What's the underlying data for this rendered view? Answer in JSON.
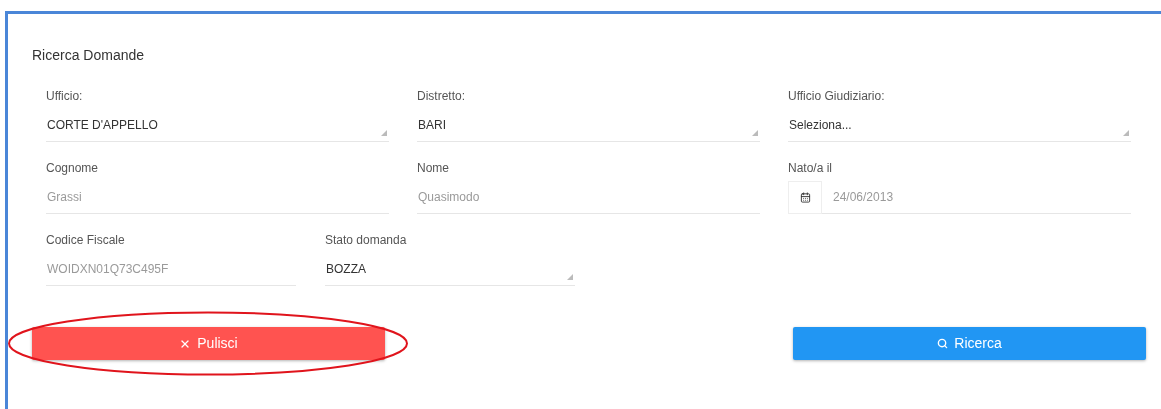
{
  "title": "Ricerca Domande",
  "rows": [
    [
      {
        "kind": "select",
        "label": "Ufficio:",
        "value": "CORTE D'APPELLO"
      },
      {
        "kind": "select",
        "label": "Distretto:",
        "value": "BARI"
      },
      {
        "kind": "select",
        "label": "Ufficio Giudiziario:",
        "value": "Seleziona..."
      }
    ],
    [
      {
        "kind": "text",
        "label": "Cognome",
        "placeholder": "Grassi"
      },
      {
        "kind": "text",
        "label": "Nome",
        "placeholder": "Quasimodo"
      },
      {
        "kind": "date",
        "label": "Nato/a il",
        "placeholder": "24/06/2013"
      }
    ],
    [
      {
        "kind": "text",
        "label": "Codice Fiscale",
        "placeholder": "WOIDXN01Q73C495F"
      },
      {
        "kind": "select",
        "label": "Stato domanda",
        "value": "BOZZA"
      }
    ]
  ],
  "buttons": [
    {
      "kind": "clear",
      "label": "Pulisci",
      "highlighted": true
    },
    {
      "kind": "search",
      "label": "Ricerca",
      "highlighted": false
    }
  ]
}
